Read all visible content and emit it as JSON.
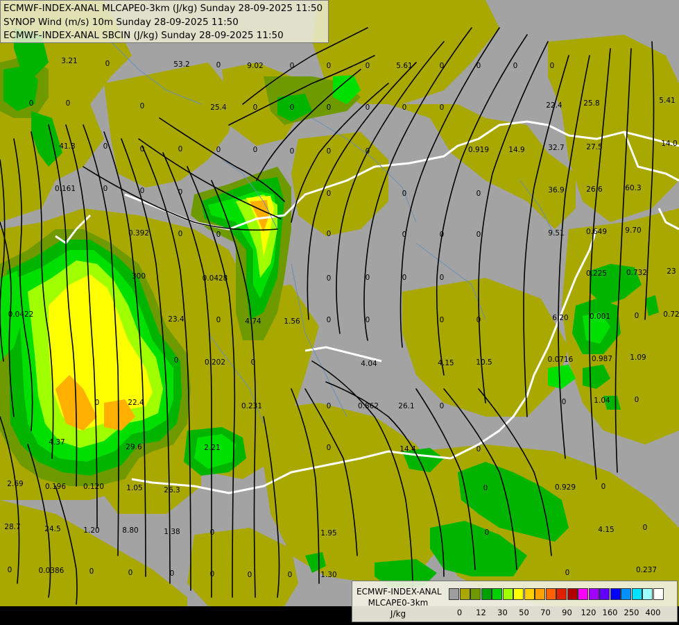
{
  "header": {
    "line1": "ECMWF-INDEX-ANAL MLCAPE0-3km (J/kg) Sunday 28-09-2025 11:50",
    "line2": "SYNOP Wind (m/s) 10m Sunday 28-09-2025 11:50",
    "line3": "ECMWF-INDEX-ANAL SBCIN (J/kg) Sunday 28-09-2025 11:50"
  },
  "legend": {
    "title_line1": "ECMWF-INDEX-ANAL",
    "title_line2": "MLCAPE0-3km",
    "unit": "J/kg",
    "colors": [
      "#9e9e9e",
      "#a8a800",
      "#6e9a00",
      "#00a000",
      "#00d000",
      "#a0ff00",
      "#ffff00",
      "#ffd000",
      "#ffa000",
      "#ff6000",
      "#e02000",
      "#b00000",
      "#ff00ff",
      "#a000ff",
      "#6000ff",
      "#0000ff",
      "#0090ff",
      "#00e0ff",
      "#a0ffff",
      "#ffffff"
    ],
    "tick_labels": [
      "0",
      "12",
      "30",
      "50",
      "70",
      "90",
      "120",
      "160",
      "250",
      "400"
    ]
  },
  "map": {
    "colors": {
      "background": "#a3a3a3",
      "cape_low": "#a8a800",
      "cape_green_dark": "#6e9a00",
      "cape_green": "#00b400",
      "cape_green_light": "#00e000",
      "cape_lime": "#a0ff00",
      "cape_yellow": "#ffff00",
      "cape_orange": "#ffb000",
      "border": "#ffffff",
      "streamline": "#000000",
      "river": "#6a8fb5"
    },
    "values": [
      "3.21",
      "0",
      "53.2",
      "0",
      "9.02",
      "0",
      "0",
      "0",
      "5.61",
      "0",
      "0",
      "0",
      "0",
      "0",
      "0",
      "0",
      "25.4",
      "0",
      "0",
      "0",
      "0",
      "0",
      "0",
      "22.4",
      "25.8",
      "5.41",
      "41.3",
      "0",
      "0",
      "0",
      "0",
      "0",
      "0",
      "0",
      "0",
      "0.919",
      "14.9",
      "32.7",
      "27.5",
      "14.0",
      "0.161",
      "0",
      "0",
      "0",
      "0",
      "0",
      "0",
      "36.9",
      "26.6",
      "60.3",
      "0.392",
      "0",
      "0",
      "0",
      "0",
      "0",
      "0",
      "9.51",
      "0.649",
      "9.70",
      "300",
      "0.0428",
      "4.74",
      "1.56",
      "0",
      "0",
      "0",
      "0",
      "0.225",
      "0.732",
      "23",
      "0.0422",
      "23.4",
      "0",
      "0",
      "0",
      "0",
      "0",
      "6.20",
      "0.001",
      "0",
      "0.72",
      "0",
      "0.202",
      "0",
      "4.04",
      "4.15",
      "10.5",
      "0.0716",
      "0.987",
      "1.09",
      "0",
      "22.4",
      "0.231",
      "0",
      "0.862",
      "26.1",
      "0",
      "0",
      "1.04",
      "0",
      "4.37",
      "29.6",
      "2.21",
      "0",
      "14.4",
      "0",
      "2.69",
      "0.196",
      "0.120",
      "1.05",
      "26.3",
      "0",
      "0.929",
      "0",
      "28.7",
      "24.5",
      "1.20",
      "8.80",
      "1.38",
      "0",
      "1.95",
      "0",
      "4.15",
      "0",
      "0",
      "0.0386",
      "0",
      "0",
      "0",
      "0",
      "0",
      "0",
      "1.30",
      "0",
      "0.237"
    ]
  }
}
